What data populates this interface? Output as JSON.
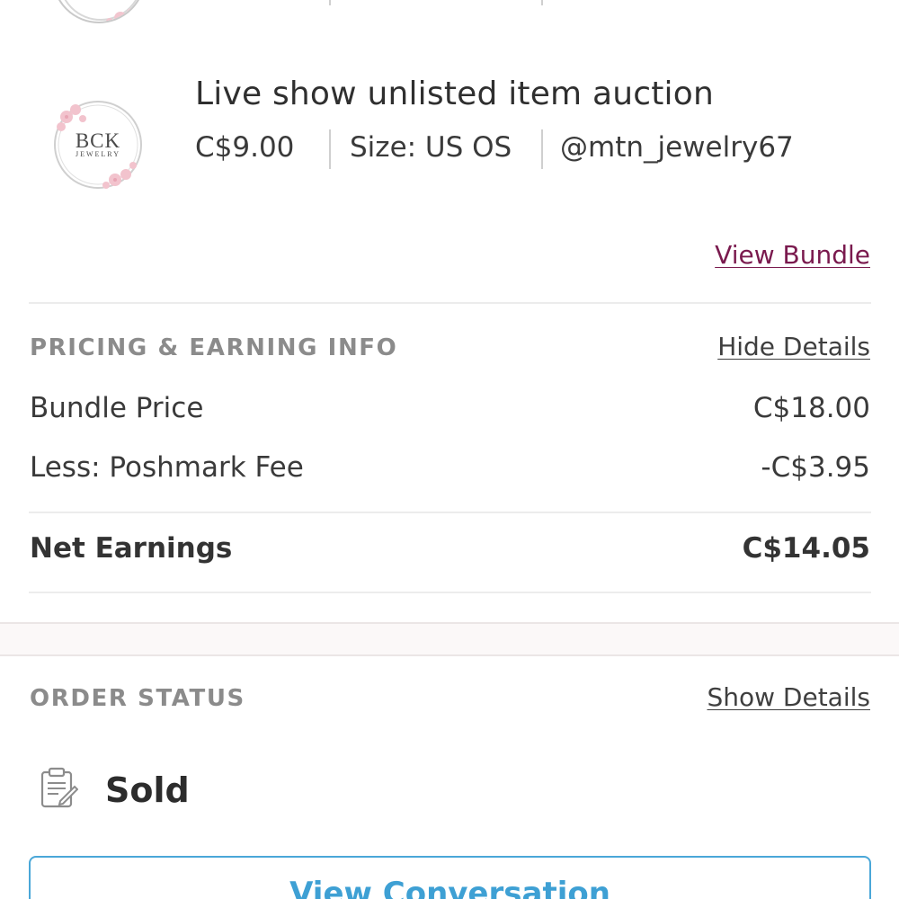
{
  "item": {
    "title": "Live show unlisted item auction",
    "price": "C$9.00",
    "size": "Size: US OS",
    "seller": "@mtn_jewelry67",
    "avatar_brand": "BCK",
    "avatar_sub": "JEWELRY"
  },
  "bundle": {
    "view_bundle_label": "View Bundle"
  },
  "pricing": {
    "section_title": "PRICING & EARNING INFO",
    "toggle_label": "Hide Details",
    "rows": [
      {
        "label": "Bundle Price",
        "value": "C$18.00"
      },
      {
        "label": "Less: Poshmark Fee",
        "value": "-C$3.95"
      }
    ],
    "net_label": "Net Earnings",
    "net_value": "C$14.05"
  },
  "order_status": {
    "section_title": "ORDER STATUS",
    "toggle_label": "Show Details",
    "status": "Sold",
    "status_icon": "clipboard-icon"
  },
  "actions": {
    "view_conversation_label": "View Conversation"
  },
  "colors": {
    "link_accent": "#7a1a4e",
    "button_accent": "#3ea0d4"
  }
}
